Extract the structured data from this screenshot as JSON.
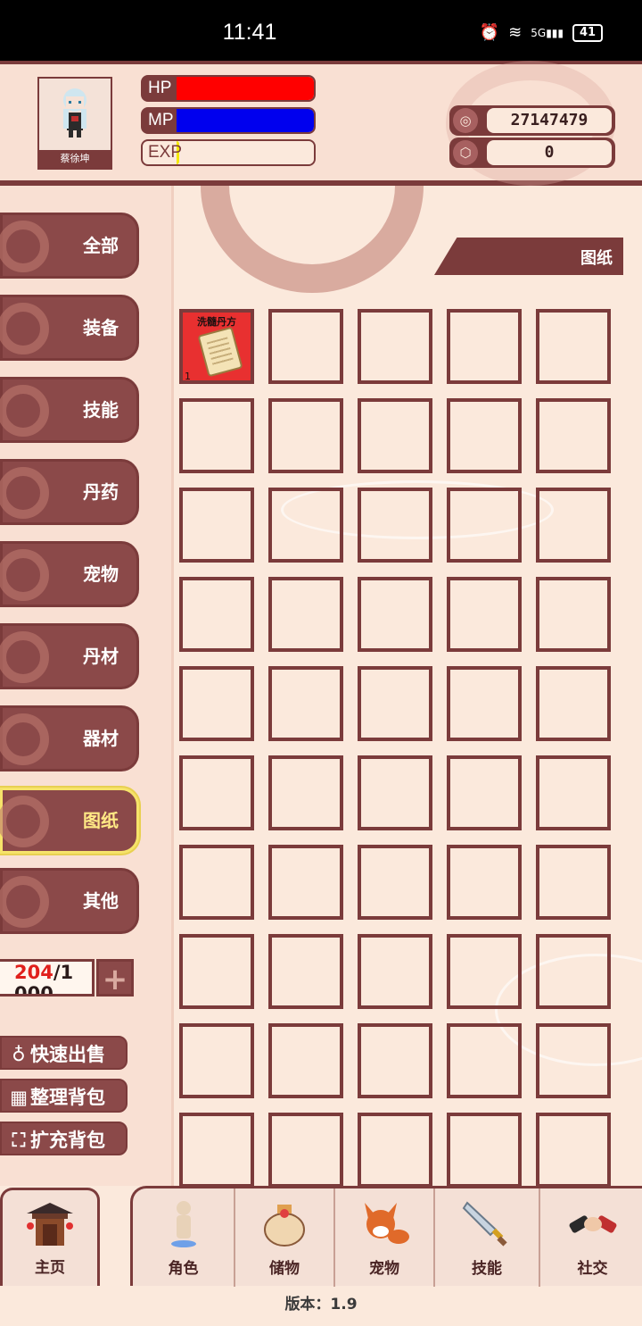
{
  "status_bar": {
    "time": "11:41",
    "battery": "41",
    "signal_label": "5G"
  },
  "header": {
    "character_name": "蔡徐坤",
    "hp_label": "HP",
    "hp_fraction": 1.0,
    "hp_color": "#ff0000",
    "mp_label": "MP",
    "mp_fraction": 1.0,
    "mp_color": "#0000ee",
    "exp_label": "EXP",
    "exp_fraction": 0.02,
    "exp_color": "#f5e900",
    "coins": "27147479",
    "gems": "0"
  },
  "sidebar": {
    "categories": [
      {
        "label": "全部",
        "active": false
      },
      {
        "label": "装备",
        "active": false
      },
      {
        "label": "技能",
        "active": false
      },
      {
        "label": "丹药",
        "active": false
      },
      {
        "label": "宠物",
        "active": false
      },
      {
        "label": "丹材",
        "active": false
      },
      {
        "label": "器材",
        "active": false
      },
      {
        "label": "图纸",
        "active": true
      },
      {
        "label": "其他",
        "active": false
      }
    ],
    "capacity_used": "204",
    "capacity_rest": "/1",
    "capacity_wrap": "000",
    "actions": {
      "quick_sell": "快速出售",
      "sort": "整理背包",
      "expand": "扩充背包"
    }
  },
  "main": {
    "section_label": "图纸",
    "items": [
      {
        "name": "洗髓丹方",
        "qty": "1"
      }
    ]
  },
  "bottom_nav": {
    "home": "主页",
    "tabs": [
      "角色",
      "储物",
      "宠物",
      "技能",
      "社交"
    ]
  },
  "version": "版本：1.9",
  "colors": {
    "accent": "#7b3b3b",
    "background": "#fbe9dc",
    "active_highlight": "#f6e36a",
    "item_bg": "#e83030"
  }
}
